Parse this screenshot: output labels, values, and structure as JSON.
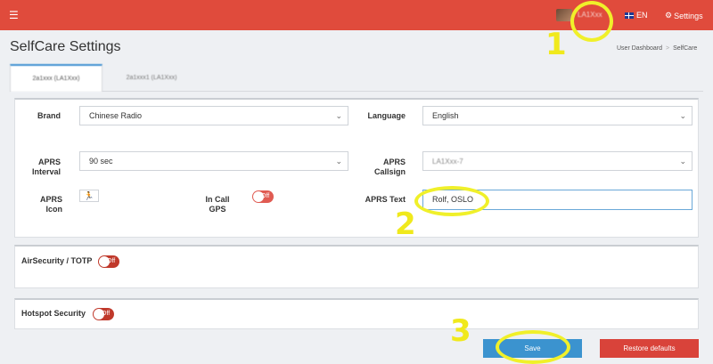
{
  "topbar": {
    "menu_icon": "hamburger-icon",
    "username": "LA1Xxx",
    "language": "EN",
    "settings_label": "Settings"
  },
  "page": {
    "title": "SelfCare Settings",
    "breadcrumb": [
      "User Dashboard",
      "SelfCare"
    ]
  },
  "tabs": [
    {
      "label": "2a1xxx (LA1Xxx)"
    },
    {
      "label": "2a1xxx1 (LA1Xxx)"
    }
  ],
  "form": {
    "brand_label": "Brand",
    "brand_value": "Chinese Radio",
    "language_label": "Language",
    "language_value": "English",
    "aprs_interval_label": [
      "APRS",
      "Interval"
    ],
    "aprs_interval_value": "90 sec",
    "aprs_callsign_label": [
      "APRS",
      "Callsign"
    ],
    "aprs_callsign_value": "LA1Xxx-7",
    "aprs_icon_label": "APRS Icon",
    "aprs_icon_glyph": "🏃",
    "in_call_gps_label": [
      "In Call",
      "GPS"
    ],
    "in_call_gps_toggle": "Off",
    "aprs_text_label": "APRS Text",
    "aprs_text_value": "Rolf, OSLO"
  },
  "sections": {
    "air_security_label": "AirSecurity / TOTP",
    "air_security_toggle": "Off",
    "hotspot_security_label": "Hotspot Security",
    "hotspot_security_toggle": "Off"
  },
  "buttons": {
    "save": "Save",
    "restore": "Restore defaults"
  },
  "annotations": {
    "marker_1": "1",
    "marker_2": "2",
    "marker_3": "3",
    "highlight_color": "#f0f02a"
  }
}
